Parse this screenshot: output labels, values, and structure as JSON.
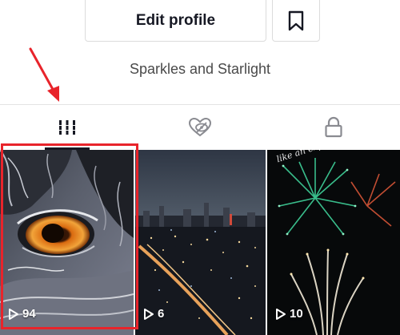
{
  "profile": {
    "edit_button_label": "Edit profile",
    "bookmark_icon": "bookmark-icon",
    "bio": "Sparkles and Starlight"
  },
  "tabs": [
    {
      "name": "videos",
      "icon": "grid-icon",
      "selected": true
    },
    {
      "name": "liked",
      "icon": "heart-hidden-icon",
      "selected": false
    },
    {
      "name": "private",
      "icon": "lock-icon",
      "selected": false
    }
  ],
  "videos": [
    {
      "subject": "owl eye close-up",
      "play_count": "94"
    },
    {
      "subject": "city skyline at night",
      "play_count": "6"
    },
    {
      "subject": "fireworks",
      "play_count": "10",
      "overlay_text": "like an exp"
    }
  ],
  "annotation": {
    "highlight_color": "#e8242b",
    "highlighted_item": "first video tile"
  }
}
